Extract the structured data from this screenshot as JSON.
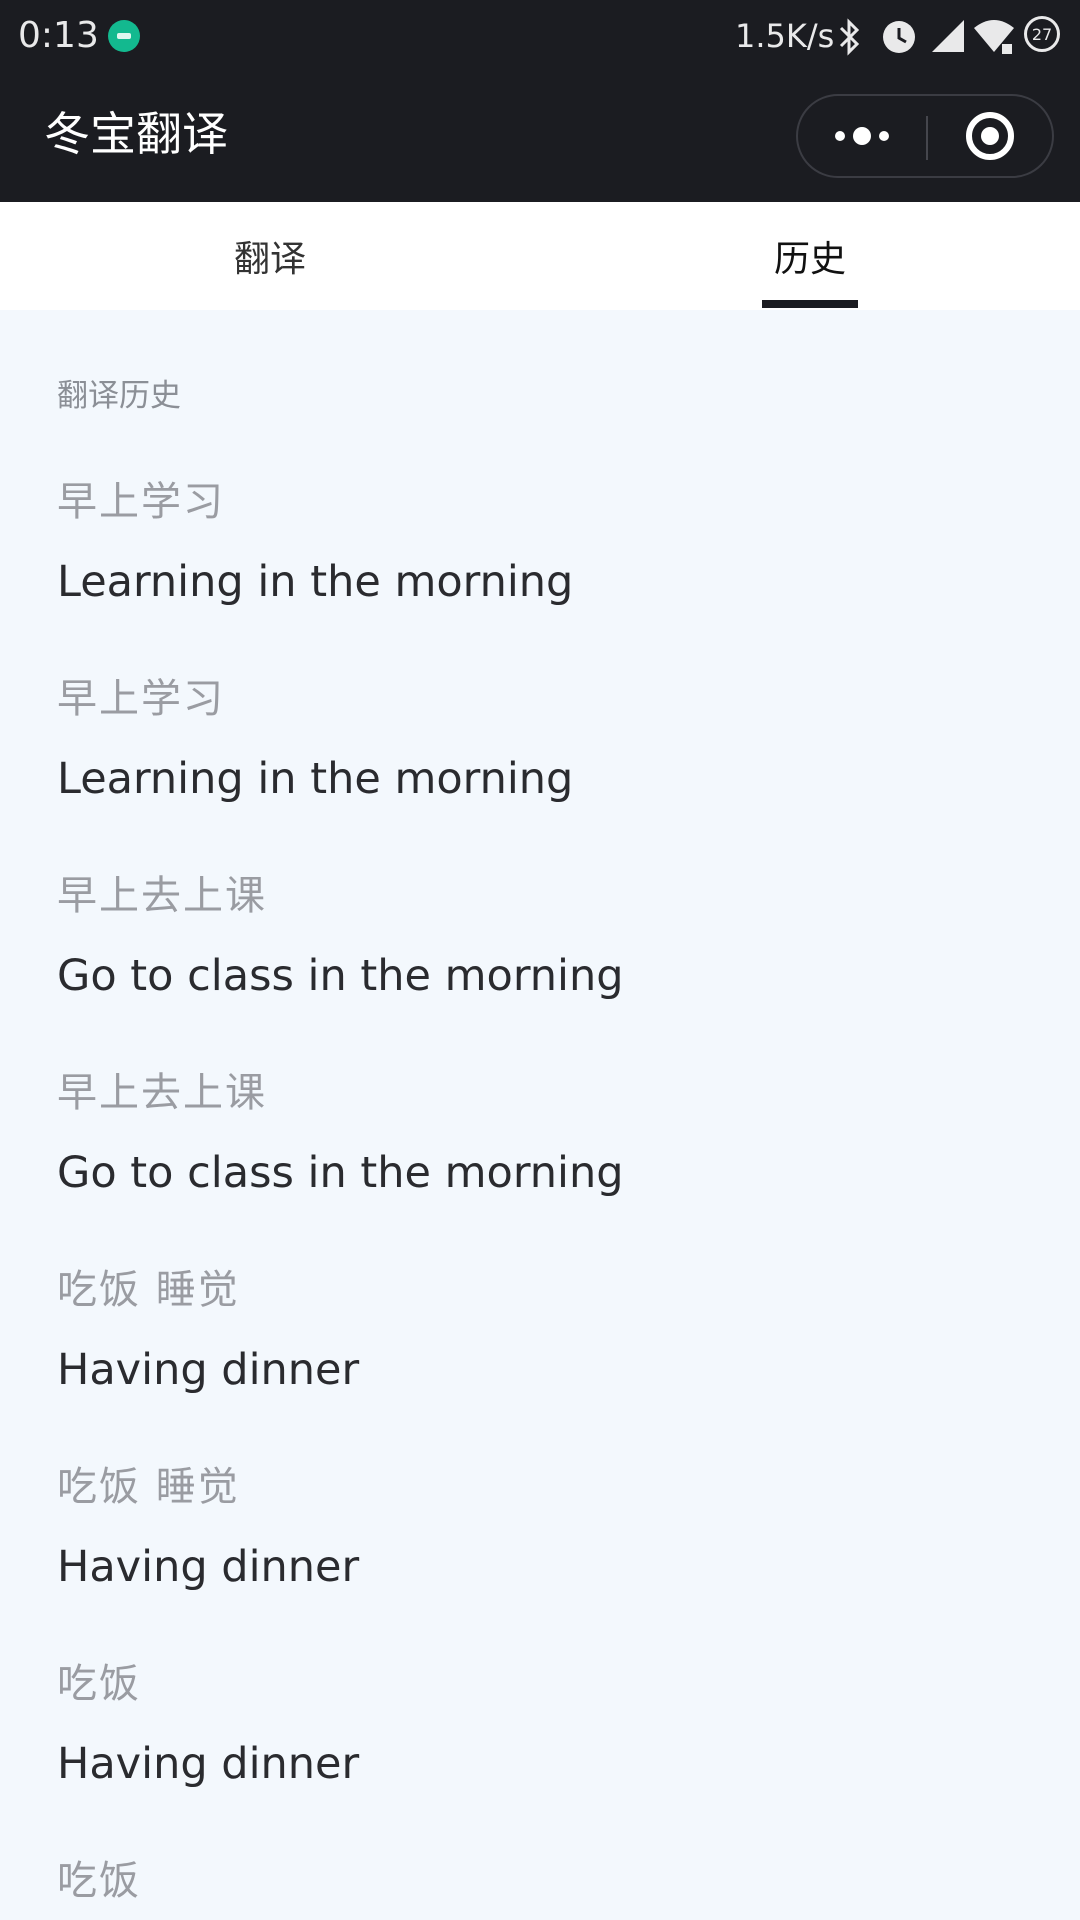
{
  "status_bar": {
    "time": "0:13",
    "net_speed": "1.5K/s",
    "battery_level": "27",
    "icons": [
      "app-notification-icon",
      "bluetooth-icon",
      "alarm-icon",
      "signal-icon",
      "wifi-icon",
      "battery-icon"
    ]
  },
  "app_bar": {
    "title": "冬宝翻译",
    "background": "#1b1c21",
    "icons": [
      "more-dots-icon",
      "close-target-icon"
    ]
  },
  "tabs": [
    {
      "label": "翻译",
      "selected": false
    },
    {
      "label": "历史",
      "selected": true
    }
  ],
  "history": {
    "section_title": "翻译历史",
    "items": [
      {
        "source": "早上学习",
        "translation": "Learning in the morning"
      },
      {
        "source": "早上学习",
        "translation": "Learning in the morning"
      },
      {
        "source": "早上去上课",
        "translation": "Go to class in the morning"
      },
      {
        "source": "早上去上课",
        "translation": "Go to class in the morning"
      },
      {
        "source": "吃饭 睡觉",
        "translation": "Having dinner"
      },
      {
        "source": "吃饭 睡觉",
        "translation": "Having dinner"
      },
      {
        "source": "吃饭",
        "translation": "Having dinner"
      },
      {
        "source": "吃饭",
        "translation": ""
      }
    ]
  }
}
